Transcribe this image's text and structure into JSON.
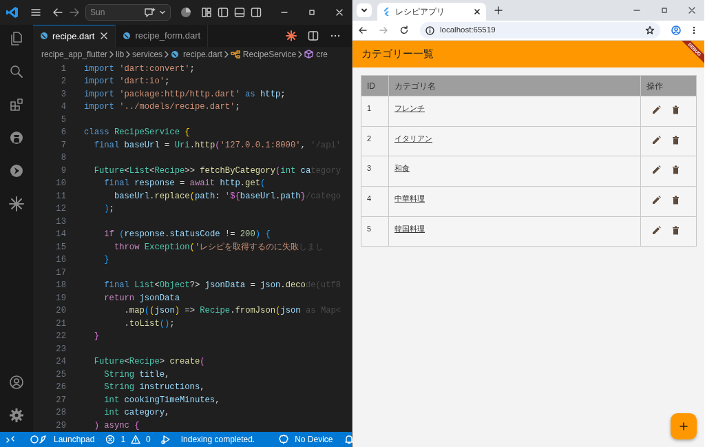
{
  "editor": {
    "search": "Sun",
    "tabs": [
      {
        "label": "recipe.dart",
        "selected": true
      },
      {
        "label": "recipe_form.dart",
        "selected": false
      }
    ],
    "breadcrumbs": [
      {
        "label": "recipe_app_flutter",
        "kind": "folder"
      },
      {
        "label": "lib",
        "kind": "folder"
      },
      {
        "label": "services",
        "kind": "folder"
      },
      {
        "label": "recipe.dart",
        "kind": "file"
      },
      {
        "label": "RecipeService",
        "kind": "class"
      },
      {
        "label": "cre",
        "kind": "method"
      }
    ],
    "lines": [
      {
        "number": "1",
        "tokens": [
          {
            "text": "import",
            "kind": "kw"
          },
          {
            "text": " 'dart:convert'",
            "kind": "s"
          },
          {
            "text": ";",
            "kind": "p"
          }
        ]
      },
      {
        "number": "2",
        "tokens": [
          {
            "text": "import",
            "kind": "kw"
          },
          {
            "text": " 'dart:io'",
            "kind": "s"
          },
          {
            "text": ";",
            "kind": "p"
          }
        ]
      },
      {
        "number": "3",
        "tokens": [
          {
            "text": "import",
            "kind": "kw"
          },
          {
            "text": " 'package:http/http.dart'",
            "kind": "s"
          },
          {
            "text": " as",
            "kind": "kw"
          },
          {
            "text": " http",
            "kind": "v"
          },
          {
            "text": ";",
            "kind": "p"
          }
        ]
      },
      {
        "number": "4",
        "tokens": [
          {
            "text": "import",
            "kind": "kw"
          },
          {
            "text": " '../models/recipe.dart'",
            "kind": "s"
          },
          {
            "text": ";",
            "kind": "p"
          }
        ]
      },
      {
        "number": "5"
      },
      {
        "number": "6",
        "tokens": [
          {
            "text": "class",
            "kind": "kw"
          },
          {
            "text": " RecipeService",
            "kind": "t"
          },
          {
            "text": " {",
            "kind": "b1"
          }
        ]
      },
      {
        "number": "7",
        "tokens": [
          {
            "text": "  final",
            "kind": "kw"
          },
          {
            "text": " baseUrl",
            "kind": "v"
          },
          {
            "text": " =",
            "kind": "p"
          },
          {
            "text": " Uri",
            "kind": "t"
          },
          {
            "text": ".",
            "kind": "p"
          },
          {
            "text": "http",
            "kind": "f"
          },
          {
            "text": "(",
            "kind": "b2"
          },
          {
            "text": "'127.0.0.1:8000'",
            "kind": "s"
          },
          {
            "text": ",",
            "kind": "p"
          },
          {
            "text": " '/api'",
            "kind": "x"
          }
        ]
      },
      {
        "number": "8"
      },
      {
        "number": "9",
        "tokens": [
          {
            "text": "  Future",
            "kind": "t"
          },
          {
            "text": "<",
            "kind": "p"
          },
          {
            "text": "List",
            "kind": "t"
          },
          {
            "text": "<",
            "kind": "p"
          },
          {
            "text": "Recipe",
            "kind": "t"
          },
          {
            "text": ">>",
            "kind": "p"
          },
          {
            "text": " fetchByCategory",
            "kind": "f"
          },
          {
            "text": "(",
            "kind": "b2"
          },
          {
            "text": "int",
            "kind": "t"
          },
          {
            "text": " ca",
            "kind": "v"
          },
          {
            "text": "tegory",
            "kind": "x"
          }
        ]
      },
      {
        "number": "10",
        "tokens": [
          {
            "text": "    final",
            "kind": "kw"
          },
          {
            "text": " response",
            "kind": "v"
          },
          {
            "text": " =",
            "kind": "p"
          },
          {
            "text": " await",
            "kind": "c"
          },
          {
            "text": " http",
            "kind": "v"
          },
          {
            "text": ".",
            "kind": "p"
          },
          {
            "text": "get",
            "kind": "f"
          },
          {
            "text": "(",
            "kind": "b3"
          }
        ]
      },
      {
        "number": "11",
        "tokens": [
          {
            "text": "      baseUrl",
            "kind": "v"
          },
          {
            "text": ".",
            "kind": "p"
          },
          {
            "text": "replace",
            "kind": "f"
          },
          {
            "text": "(",
            "kind": "b1"
          },
          {
            "text": "path",
            "kind": "v"
          },
          {
            "text": ":",
            "kind": "p"
          },
          {
            "text": " '",
            "kind": "s"
          },
          {
            "text": "${",
            "kind": "b2"
          },
          {
            "text": "baseUrl",
            "kind": "v"
          },
          {
            "text": ".",
            "kind": "p"
          },
          {
            "text": "path",
            "kind": "v"
          },
          {
            "text": "}",
            "kind": "b2"
          },
          {
            "text": "/catego",
            "kind": "x"
          }
        ]
      },
      {
        "number": "12",
        "tokens": [
          {
            "text": "    )",
            "kind": "b3"
          },
          {
            "text": ";",
            "kind": "p"
          }
        ]
      },
      {
        "number": "13"
      },
      {
        "number": "14",
        "tokens": [
          {
            "text": "    if",
            "kind": "c"
          },
          {
            "text": " (",
            "kind": "b3"
          },
          {
            "text": "response",
            "kind": "v"
          },
          {
            "text": ".",
            "kind": "p"
          },
          {
            "text": "statusCode",
            "kind": "v"
          },
          {
            "text": " !=",
            "kind": "p"
          },
          {
            "text": " 200",
            "kind": "n"
          },
          {
            "text": ")",
            "kind": "b3"
          },
          {
            "text": " {",
            "kind": "b3"
          }
        ]
      },
      {
        "number": "15",
        "tokens": [
          {
            "text": "      throw",
            "kind": "c"
          },
          {
            "text": " Exception",
            "kind": "t"
          },
          {
            "text": "(",
            "kind": "b1"
          },
          {
            "text": "'レシピを取得するのに失敗",
            "kind": "s"
          },
          {
            "text": "しまし",
            "kind": "x"
          }
        ]
      },
      {
        "number": "16",
        "tokens": [
          {
            "text": "    }",
            "kind": "b3"
          }
        ]
      },
      {
        "number": "17"
      },
      {
        "number": "18",
        "tokens": [
          {
            "text": "    final",
            "kind": "kw"
          },
          {
            "text": " List",
            "kind": "t"
          },
          {
            "text": "<",
            "kind": "p"
          },
          {
            "text": "Object",
            "kind": "t"
          },
          {
            "text": "?>",
            "kind": "p"
          },
          {
            "text": " jsonData",
            "kind": "v"
          },
          {
            "text": " =",
            "kind": "p"
          },
          {
            "text": " json",
            "kind": "v"
          },
          {
            "text": ".",
            "kind": "p"
          },
          {
            "text": "deco",
            "kind": "f"
          },
          {
            "text": "de(utf8",
            "kind": "x"
          }
        ]
      },
      {
        "number": "19",
        "tokens": [
          {
            "text": "    return",
            "kind": "c"
          },
          {
            "text": " jsonData",
            "kind": "v"
          }
        ]
      },
      {
        "number": "20",
        "tokens": [
          {
            "text": "        .",
            "kind": "p"
          },
          {
            "text": "map",
            "kind": "f"
          },
          {
            "text": "(",
            "kind": "b3"
          },
          {
            "text": "(",
            "kind": "b1"
          },
          {
            "text": "json",
            "kind": "v"
          },
          {
            "text": ")",
            "kind": "b1"
          },
          {
            "text": " =>",
            "kind": "p"
          },
          {
            "text": " Recipe",
            "kind": "t"
          },
          {
            "text": ".",
            "kind": "p"
          },
          {
            "text": "fromJson",
            "kind": "f"
          },
          {
            "text": "(",
            "kind": "b1"
          },
          {
            "text": "json",
            "kind": "v"
          },
          {
            "text": " as Map<",
            "kind": "x"
          }
        ]
      },
      {
        "number": "21",
        "tokens": [
          {
            "text": "        .",
            "kind": "p"
          },
          {
            "text": "toList",
            "kind": "f"
          },
          {
            "text": "()",
            "kind": "b3"
          },
          {
            "text": ";",
            "kind": "p"
          }
        ]
      },
      {
        "number": "22",
        "tokens": [
          {
            "text": "  }",
            "kind": "b2"
          }
        ]
      },
      {
        "number": "23"
      },
      {
        "number": "24",
        "tokens": [
          {
            "text": "  Future",
            "kind": "t"
          },
          {
            "text": "<",
            "kind": "p"
          },
          {
            "text": "Recipe",
            "kind": "t"
          },
          {
            "text": ">",
            "kind": "p"
          },
          {
            "text": " create",
            "kind": "f"
          },
          {
            "text": "(",
            "kind": "b2"
          }
        ]
      },
      {
        "number": "25",
        "tokens": [
          {
            "text": "    String",
            "kind": "t"
          },
          {
            "text": " title",
            "kind": "v"
          },
          {
            "text": ",",
            "kind": "p"
          }
        ]
      },
      {
        "number": "26",
        "tokens": [
          {
            "text": "    String",
            "kind": "t"
          },
          {
            "text": " instructions",
            "kind": "v"
          },
          {
            "text": ",",
            "kind": "p"
          }
        ]
      },
      {
        "number": "27",
        "tokens": [
          {
            "text": "    int",
            "kind": "t"
          },
          {
            "text": " cookingTimeMinutes",
            "kind": "v"
          },
          {
            "text": ",",
            "kind": "p"
          }
        ]
      },
      {
        "number": "28",
        "tokens": [
          {
            "text": "    int",
            "kind": "t"
          },
          {
            "text": " category",
            "kind": "v"
          },
          {
            "text": ",",
            "kind": "p"
          }
        ]
      },
      {
        "number": "29",
        "tokens": [
          {
            "text": "  )",
            "kind": "b2"
          },
          {
            "text": " async",
            "kind": "c"
          },
          {
            "text": " {",
            "kind": "b2"
          }
        ]
      }
    ],
    "status_bar": {
      "launchpad": "Launchpad",
      "errors": "1",
      "warnings": "0",
      "message": "Indexing completed.",
      "device": "No Device"
    }
  },
  "browser": {
    "tab_title": "レシピアプリ",
    "address": "localhost:65519",
    "app": {
      "title": "カテゴリー一覧",
      "debug_banner": "DEBUG",
      "table": {
        "columns": [
          "ID",
          "カテゴリ名",
          "操作"
        ],
        "rows": [
          {
            "id": "1",
            "name": "フレンチ"
          },
          {
            "id": "2",
            "name": "イタリアン"
          },
          {
            "id": "3",
            "name": "和食"
          },
          {
            "id": "4",
            "name": "中華料理"
          },
          {
            "id": "5",
            "name": "韓国料理"
          }
        ]
      }
    }
  }
}
